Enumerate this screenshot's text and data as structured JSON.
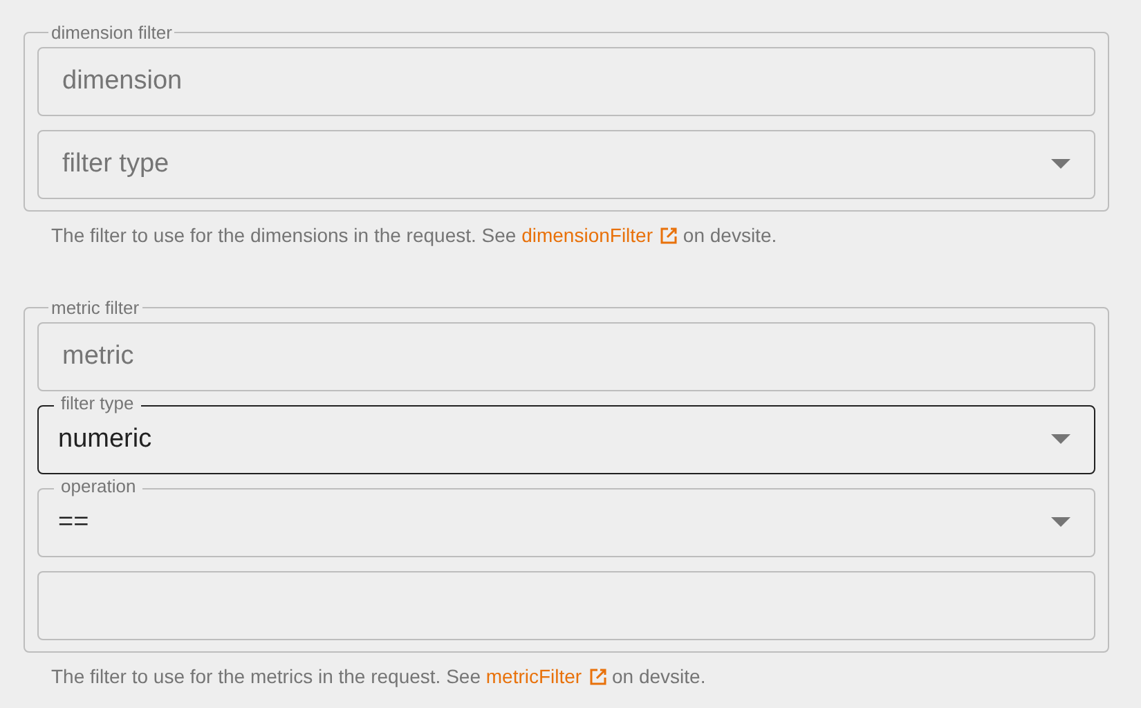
{
  "groups": [
    {
      "title": "dimension filter",
      "fields": [
        {
          "kind": "text",
          "placeholder": "dimension",
          "focused": false
        },
        {
          "kind": "select",
          "placeholder": "filter type",
          "focused": false
        }
      ],
      "help": {
        "before": "The filter to use for the dimensions in the request. See ",
        "link": "dimensionFilter",
        "after": "on devsite."
      }
    },
    {
      "title": "metric filter",
      "fields": [
        {
          "kind": "text",
          "placeholder": "metric",
          "focused": false
        },
        {
          "kind": "select",
          "label": "filter type",
          "value": "numeric",
          "focused": true
        },
        {
          "kind": "select",
          "label": "operation",
          "value": "==",
          "focused": false
        },
        {
          "kind": "text",
          "focused": false
        }
      ],
      "help": {
        "before": "The filter to use for the metrics in the request. See ",
        "link": "metricFilter",
        "after": "on devsite."
      }
    }
  ]
}
